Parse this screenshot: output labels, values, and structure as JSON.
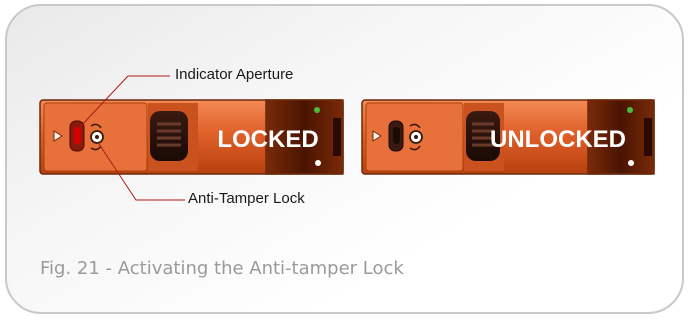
{
  "diagram": {
    "callouts": {
      "indicator_aperture": "Indicator Aperture",
      "anti_tamper_lock": "Anti-Tamper Lock"
    },
    "panels": {
      "locked_text": "LOCKED",
      "unlocked_text": "UNLOCKED"
    },
    "caption": "Fig. 21 - Activating the Anti-tamper Lock"
  },
  "colors": {
    "panel_orange": "#e0602a",
    "panel_dark": "#5a1a05",
    "indicator_red": "#d40000",
    "frame_border": "#c9c9c9",
    "caption_gray": "#9a9a9a"
  }
}
